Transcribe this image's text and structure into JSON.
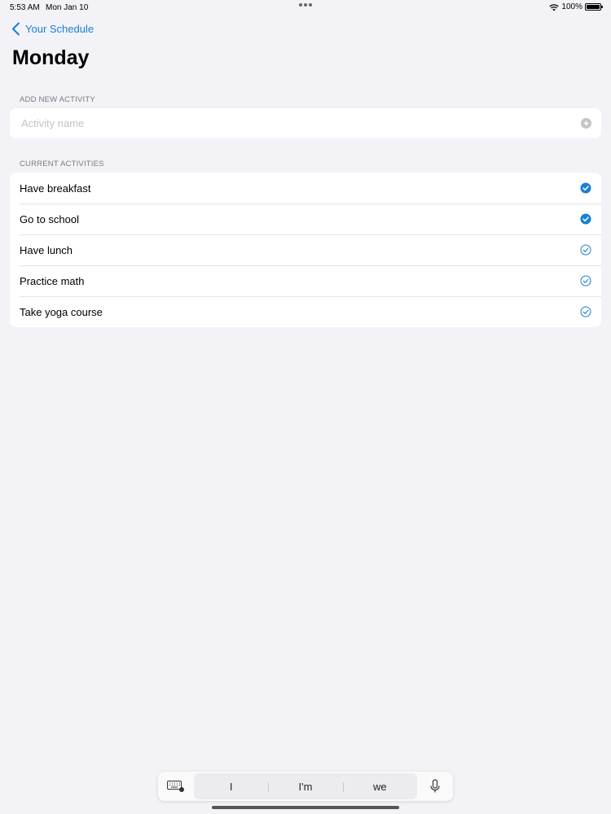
{
  "status_bar": {
    "time": "5:53 AM",
    "date": "Mon Jan 10",
    "battery": "100%"
  },
  "nav": {
    "back_label": "Your Schedule",
    "title": "Monday"
  },
  "add_section": {
    "header": "ADD NEW ACTIVITY",
    "placeholder": "Activity name",
    "value": ""
  },
  "current_section": {
    "header": "CURRENT ACTIVITIES",
    "activities": [
      {
        "label": "Have breakfast",
        "done": true
      },
      {
        "label": "Go to school",
        "done": true
      },
      {
        "label": "Have lunch",
        "done": false
      },
      {
        "label": "Practice math",
        "done": false
      },
      {
        "label": "Take yoga course",
        "done": false
      }
    ]
  },
  "keyboard_bar": {
    "suggestions": [
      "I",
      "I'm",
      "we"
    ]
  },
  "colors": {
    "accent": "#1a7fd1",
    "background": "#f2f2f7"
  }
}
